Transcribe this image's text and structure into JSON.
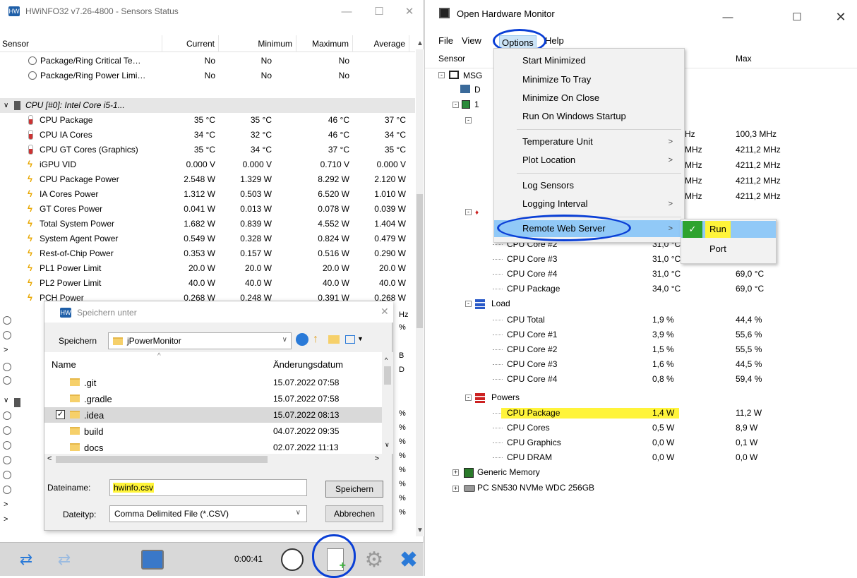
{
  "hwinfo": {
    "title": "HWiNFO32 v7.26-4800 - Sensors Status",
    "columns": [
      "Sensor",
      "Current",
      "Minimum",
      "Maximum",
      "Average"
    ],
    "rows_top": [
      {
        "name": "Package/Ring Critical Te…",
        "current": "No",
        "minimum": "No",
        "maximum": "No",
        "average": "",
        "icon": "clock-icon"
      },
      {
        "name": "Package/Ring Power Limi…",
        "current": "No",
        "minimum": "No",
        "maximum": "No",
        "average": "",
        "icon": "clock-icon"
      }
    ],
    "group_label": "CPU [#0]: Intel Core i5-1...",
    "rows": [
      {
        "name": "CPU Package",
        "current": "35 °C",
        "minimum": "35 °C",
        "maximum": "46 °C",
        "average": "37 °C",
        "icon": "thermometer-icon"
      },
      {
        "name": "CPU IA Cores",
        "current": "34 °C",
        "minimum": "32 °C",
        "maximum": "46 °C",
        "average": "34 °C",
        "icon": "thermometer-icon"
      },
      {
        "name": "CPU GT Cores (Graphics)",
        "current": "35 °C",
        "minimum": "34 °C",
        "maximum": "37 °C",
        "average": "35 °C",
        "icon": "thermometer-icon"
      },
      {
        "name": "iGPU VID",
        "current": "0.000 V",
        "minimum": "0.000 V",
        "maximum": "0.710 V",
        "average": "0.000 V",
        "icon": "bolt-icon"
      },
      {
        "name": "CPU Package Power",
        "current": "2.548 W",
        "minimum": "1.329 W",
        "maximum": "8.292 W",
        "average": "2.120 W",
        "icon": "bolt-icon",
        "highlight": true
      },
      {
        "name": "IA Cores Power",
        "current": "1.312 W",
        "minimum": "0.503 W",
        "maximum": "6.520 W",
        "average": "1.010 W",
        "icon": "bolt-icon"
      },
      {
        "name": "GT Cores Power",
        "current": "0.041 W",
        "minimum": "0.013 W",
        "maximum": "0.078 W",
        "average": "0.039 W",
        "icon": "bolt-icon"
      },
      {
        "name": "Total System Power",
        "current": "1.682 W",
        "minimum": "0.839 W",
        "maximum": "4.552 W",
        "average": "1.404 W",
        "icon": "bolt-icon"
      },
      {
        "name": "System Agent Power",
        "current": "0.549 W",
        "minimum": "0.328 W",
        "maximum": "0.824 W",
        "average": "0.479 W",
        "icon": "bolt-icon"
      },
      {
        "name": "Rest-of-Chip Power",
        "current": "0.353 W",
        "minimum": "0.157 W",
        "maximum": "0.516 W",
        "average": "0.290 W",
        "icon": "bolt-icon"
      },
      {
        "name": "PL1 Power Limit",
        "current": "20.0 W",
        "minimum": "20.0 W",
        "maximum": "20.0 W",
        "average": "20.0 W",
        "icon": "bolt-icon"
      },
      {
        "name": "PL2 Power Limit",
        "current": "40.0 W",
        "minimum": "40.0 W",
        "maximum": "40.0 W",
        "average": "40.0 W",
        "icon": "bolt-icon"
      },
      {
        "name": "PCH Power",
        "current": "0.268 W",
        "minimum": "0.248 W",
        "maximum": "0.391 W",
        "average": "0.268 W",
        "icon": "bolt-icon"
      }
    ],
    "right_edge_partials": [
      "Hz",
      "%",
      "",
      "B",
      "D",
      "",
      "",
      "%",
      "%",
      "%",
      "%",
      "%",
      "%",
      "%",
      "%"
    ],
    "timer": "0:00:41"
  },
  "save_dialog": {
    "title": "Speichern unter",
    "location_label": "Speichern",
    "location_value": "jPowerMonitor",
    "col_name": "Name",
    "col_date": "Änderungsdatum",
    "files": [
      {
        "name": ".git",
        "date": "15.07.2022 07:58",
        "selected": false
      },
      {
        "name": ".gradle",
        "date": "15.07.2022 07:58",
        "selected": false
      },
      {
        "name": ".idea",
        "date": "15.07.2022 08:13",
        "selected": true
      },
      {
        "name": "build",
        "date": "04.07.2022 09:35",
        "selected": false
      },
      {
        "name": "docs",
        "date": "02.07.2022 11:13",
        "selected": false
      }
    ],
    "filename_label": "Dateiname:",
    "filename_value": "hwinfo.csv",
    "filetype_label": "Dateityp:",
    "filetype_value": "Comma Delimited File (*.CSV)",
    "save_button": "Speichern",
    "cancel_button": "Abbrechen"
  },
  "ohm": {
    "title": "Open Hardware Monitor",
    "menubar": [
      "File",
      "View",
      "Options",
      "Help"
    ],
    "col_sensor": "Sensor",
    "col_max": "Max",
    "tree_partial": [
      "MSG",
      "D",
      "1"
    ],
    "clock_rows": [
      {
        "value_partial": "Hz",
        "max": "100,3 MHz"
      },
      {
        "value_partial": "MHz",
        "max": "4211,2 MHz"
      },
      {
        "value_partial": "MHz",
        "max": "4211,2 MHz"
      },
      {
        "value_partial": "MHz",
        "max": "4211,2 MHz"
      },
      {
        "value_partial": "MHz",
        "max": "4211,2 MHz"
      }
    ],
    "temp_rows": [
      {
        "name": "CPU Core #2",
        "value": "31,0 °C",
        "max": ""
      },
      {
        "name": "CPU Core #3",
        "value": "31,0 °C",
        "max": ""
      },
      {
        "name": "CPU Core #4",
        "value": "31,0 °C",
        "max": "69,0 °C"
      },
      {
        "name": "CPU Package",
        "value": "34,0 °C",
        "max": "69,0 °C"
      }
    ],
    "load_label": "Load",
    "load_rows": [
      {
        "name": "CPU Total",
        "value": "1,9 %",
        "max": "44,4 %"
      },
      {
        "name": "CPU Core #1",
        "value": "3,9 %",
        "max": "55,6 %"
      },
      {
        "name": "CPU Core #2",
        "value": "1,5 %",
        "max": "55,5 %"
      },
      {
        "name": "CPU Core #3",
        "value": "1,6 %",
        "max": "44,5 %"
      },
      {
        "name": "CPU Core #4",
        "value": "0,8 %",
        "max": "59,4 %"
      }
    ],
    "powers_label": "Powers",
    "power_rows": [
      {
        "name": "CPU Package",
        "value": "1,4 W",
        "max": "11,2 W",
        "highlight": true
      },
      {
        "name": "CPU Cores",
        "value": "0,5 W",
        "max": "8,9 W"
      },
      {
        "name": "CPU Graphics",
        "value": "0,0 W",
        "max": "0,1 W"
      },
      {
        "name": "CPU DRAM",
        "value": "0,0 W",
        "max": "0,0 W"
      }
    ],
    "generic_memory": "Generic Memory",
    "ssd": "PC SN530 NVMe WDC 256GB",
    "options_menu": [
      "Start Minimized",
      "Minimize To Tray",
      "Minimize On Close",
      "Run On Windows Startup",
      "Temperature Unit",
      "Plot Location",
      "Log Sensors",
      "Logging Interval",
      "Remote Web Server"
    ],
    "submenu": [
      "Run",
      "Port"
    ]
  },
  "colors": {
    "highlight": "#fff43a",
    "annotation": "#0a3fd6",
    "menu_hover": "#91c9f7"
  }
}
